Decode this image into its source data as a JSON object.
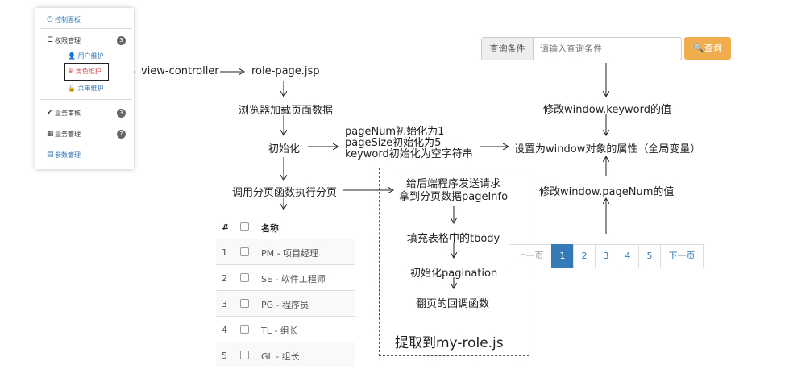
{
  "sidebar": {
    "dashboard": "控制面板",
    "permission_group": {
      "label": "权限管理",
      "badge": "3"
    },
    "permission_items": [
      "用户维护",
      "角色维护",
      "菜单维护"
    ],
    "business_review": {
      "label": "业务审核",
      "badge": "3"
    },
    "business_manage": {
      "label": "业务管理",
      "badge": "7"
    },
    "params": "参数管理"
  },
  "flow": {
    "view_controller": "view-controller",
    "role_page": "role-page.jsp",
    "browser_load": "浏览器加载页面数据",
    "init": "初始化",
    "init_details": [
      "pageNum初始化为1",
      "pageSize初始化为5",
      "keyword初始化为空字符串"
    ],
    "call_paging": "调用分页函数执行分页",
    "set_global": "设置为window对象的属性（全局变量）",
    "modify_keyword": "修改window.keyword的值",
    "modify_pagenum": "修改window.pageNum的值"
  },
  "dashed_box": {
    "send_request": [
      "给后端程序发送请求",
      "拿到分页数据pageInfo"
    ],
    "fill_tbody": "填充表格中的tbody",
    "init_pagination": "初始化pagination",
    "page_callback": "翻页的回调函数",
    "extract": "提取到my-role.js"
  },
  "search": {
    "addon": "查询条件",
    "placeholder": "请输入查询条件",
    "button": "查询"
  },
  "table": {
    "headers": [
      "#",
      "",
      "名称"
    ],
    "rows": [
      [
        "1",
        "PM - 项目经理"
      ],
      [
        "2",
        "SE - 软件工程师"
      ],
      [
        "3",
        "PG - 程序员"
      ],
      [
        "4",
        "TL - 组长"
      ],
      [
        "5",
        "GL - 组长"
      ]
    ]
  },
  "pagination": {
    "prev": "上一页",
    "pages": [
      "1",
      "2",
      "3",
      "4",
      "5"
    ],
    "next": "下一页",
    "active": "1"
  },
  "colors": {
    "accent": "#337ab7",
    "search_button": "#f0ad4e",
    "highlight": "#d9534f"
  }
}
